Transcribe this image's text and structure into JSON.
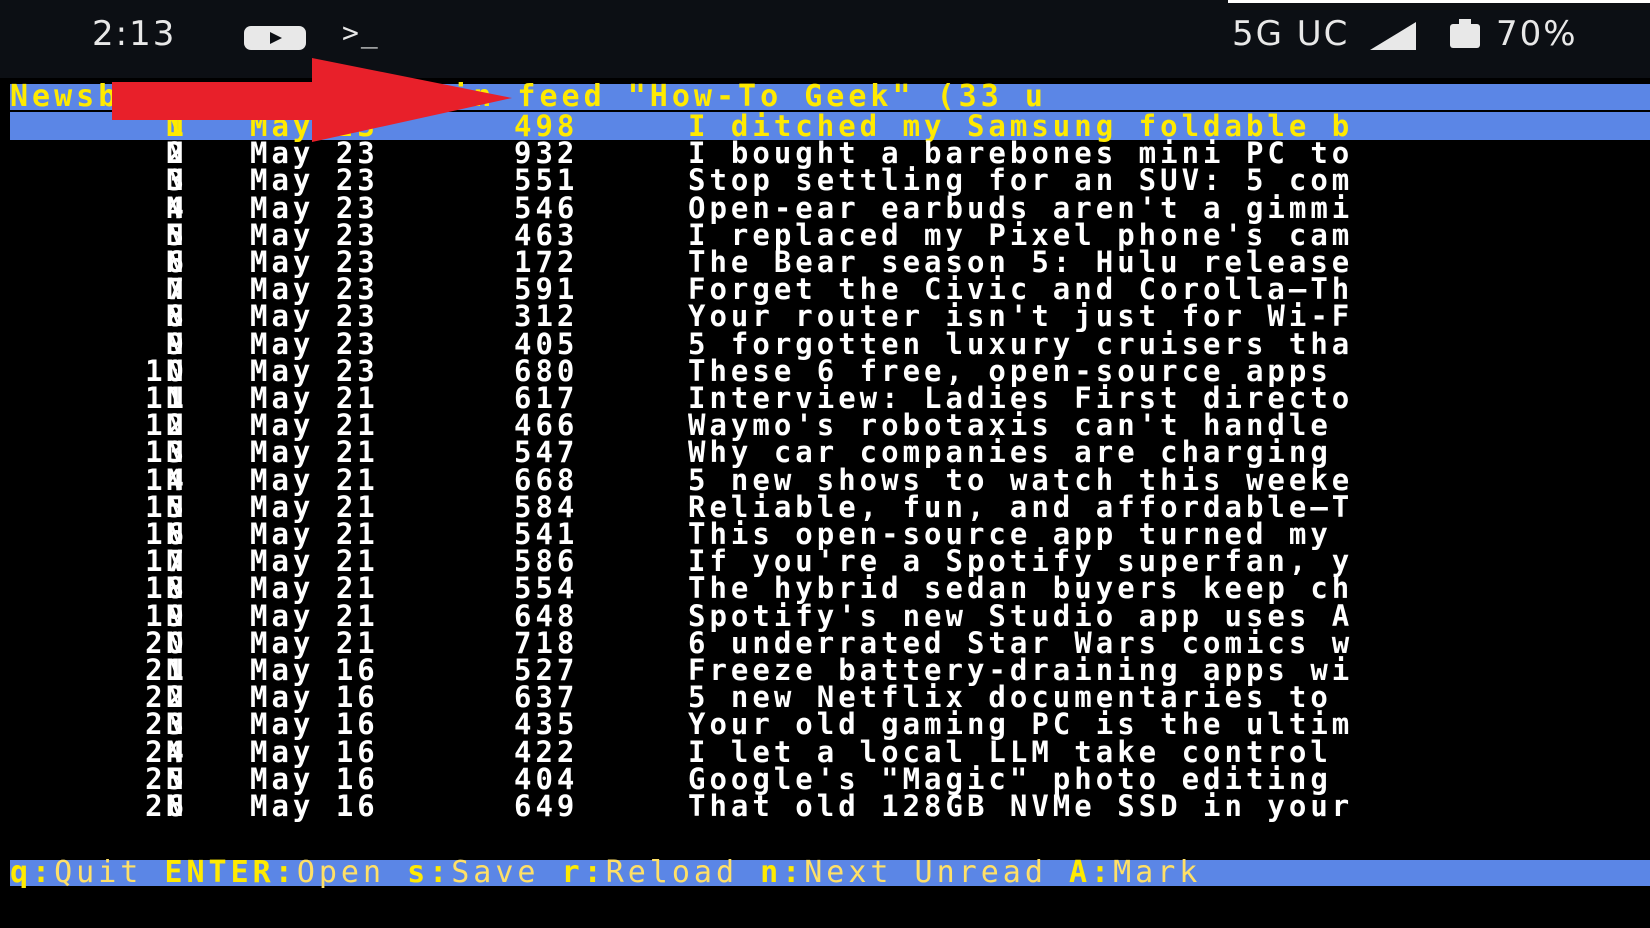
{
  "statusbar": {
    "time": "2:13",
    "network": "5G UC",
    "battery": "70%"
  },
  "title_bar": "Newsboat - Articles in feed \"How-To Geek\" (33 u",
  "articles": [
    {
      "num": "1",
      "flag": "N",
      "date": "May 23",
      "size": "498",
      "title": "I ditched my Samsung foldable b",
      "selected": true
    },
    {
      "num": "2",
      "flag": "N",
      "date": "May 23",
      "size": "932",
      "title": "I bought a barebones mini PC to"
    },
    {
      "num": "3",
      "flag": "N",
      "date": "May 23",
      "size": "551",
      "title": "Stop settling for an SUV: 5 com"
    },
    {
      "num": "4",
      "flag": "N",
      "date": "May 23",
      "size": "546",
      "title": "Open-ear earbuds aren't a gimmi"
    },
    {
      "num": "5",
      "flag": "N",
      "date": "May 23",
      "size": "463",
      "title": "I replaced my Pixel phone's cam"
    },
    {
      "num": "6",
      "flag": "N",
      "date": "May 23",
      "size": "172",
      "title": "The Bear season 5: Hulu release"
    },
    {
      "num": "7",
      "flag": "N",
      "date": "May 23",
      "size": "591",
      "title": "Forget the Civic and Corolla—Th"
    },
    {
      "num": "8",
      "flag": "N",
      "date": "May 23",
      "size": "312",
      "title": "Your router isn't just for Wi-F"
    },
    {
      "num": "9",
      "flag": "N",
      "date": "May 23",
      "size": "405",
      "title": "5 forgotten luxury cruisers tha"
    },
    {
      "num": "10",
      "flag": "N",
      "date": "May 23",
      "size": "680",
      "title": "These 6 free, open-source apps"
    },
    {
      "num": "11",
      "flag": "N",
      "date": "May 21",
      "size": "617",
      "title": "Interview: Ladies First directo"
    },
    {
      "num": "12",
      "flag": "N",
      "date": "May 21",
      "size": "466",
      "title": "Waymo's robotaxis can't handle"
    },
    {
      "num": "13",
      "flag": "N",
      "date": "May 21",
      "size": "547",
      "title": "Why car companies are charging"
    },
    {
      "num": "14",
      "flag": "N",
      "date": "May 21",
      "size": "668",
      "title": "5 new shows to watch this weeke"
    },
    {
      "num": "15",
      "flag": "N",
      "date": "May 21",
      "size": "584",
      "title": "Reliable, fun, and affordable—T"
    },
    {
      "num": "16",
      "flag": "N",
      "date": "May 21",
      "size": "541",
      "title": "This open-source app turned my"
    },
    {
      "num": "17",
      "flag": "N",
      "date": "May 21",
      "size": "586",
      "title": "If you're a Spotify superfan, y"
    },
    {
      "num": "18",
      "flag": "N",
      "date": "May 21",
      "size": "554",
      "title": "The hybrid sedan buyers keep ch"
    },
    {
      "num": "19",
      "flag": "N",
      "date": "May 21",
      "size": "648",
      "title": "Spotify's new Studio app uses A"
    },
    {
      "num": "20",
      "flag": "N",
      "date": "May 21",
      "size": "718",
      "title": "6 underrated Star Wars comics w"
    },
    {
      "num": "21",
      "flag": "N",
      "date": "May 16",
      "size": "527",
      "title": "Freeze battery-draining apps wi"
    },
    {
      "num": "22",
      "flag": "N",
      "date": "May 16",
      "size": "637",
      "title": "5 new Netflix documentaries to"
    },
    {
      "num": "23",
      "flag": "N",
      "date": "May 16",
      "size": "435",
      "title": "Your old gaming PC is the ultim"
    },
    {
      "num": "24",
      "flag": "N",
      "date": "May 16",
      "size": "422",
      "title": "I let a local LLM take control"
    },
    {
      "num": "25",
      "flag": "N",
      "date": "May 16",
      "size": "404",
      "title": "Google's \"Magic\" photo editing"
    },
    {
      "num": "26",
      "flag": "N",
      "date": "May 16",
      "size": "649",
      "title": "That old 128GB NVMe SSD in your"
    }
  ],
  "footer": [
    {
      "key": "q:",
      "label": "Quit"
    },
    {
      "key": "ENTER:",
      "label": "Open"
    },
    {
      "key": "s:",
      "label": "Save"
    },
    {
      "key": "r:",
      "label": "Reload"
    },
    {
      "key": "n:",
      "label": "Next Unread"
    },
    {
      "key": "A:",
      "label": "Mark"
    }
  ],
  "colors": {
    "bar_bg": "#5b86e6",
    "bar_text": "#ffea00",
    "annotation_arrow": "#e8202a"
  }
}
